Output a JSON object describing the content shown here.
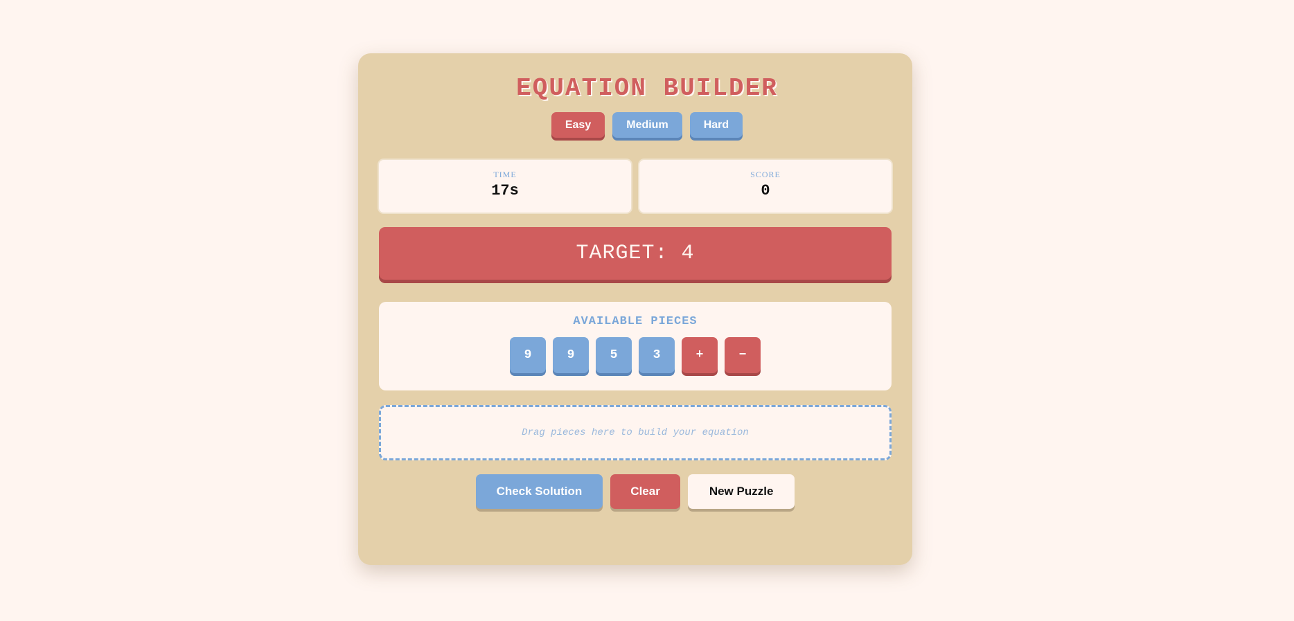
{
  "title": "EQUATION BUILDER",
  "difficulty": {
    "options": [
      "Easy",
      "Medium",
      "Hard"
    ],
    "selected": "Easy"
  },
  "stats": {
    "time_label": "TIME",
    "time_value": "17s",
    "score_label": "SCORE",
    "score_value": "0"
  },
  "target": {
    "text": "TARGET: 4"
  },
  "pieces": {
    "title": "AVAILABLE PIECES",
    "items": [
      "9",
      "9",
      "5",
      "3",
      "+",
      "−"
    ]
  },
  "dropzone": {
    "placeholder": "Drag pieces here to build your equation"
  },
  "actions": {
    "check_label": "Check Solution",
    "clear_label": "Clear",
    "new_label": "New Puzzle"
  },
  "colors": {
    "background": "#fff5f0",
    "card": "#e4d0aa",
    "accent_red": "#d05e5e",
    "accent_blue": "#7ba7d9"
  }
}
